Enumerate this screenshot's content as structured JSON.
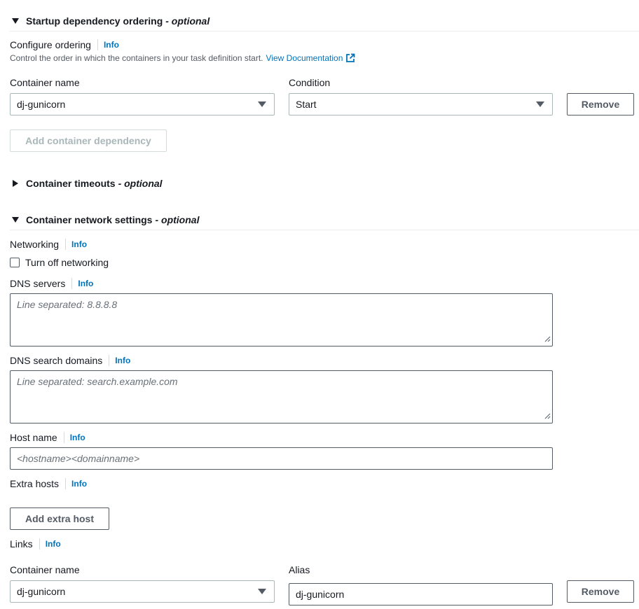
{
  "startup": {
    "title": "Startup dependency ordering",
    "optional": "- optional",
    "configure_label": "Configure ordering",
    "info": "Info",
    "description": "Control the order in which the containers in your task definition start.",
    "doc_link": "View Documentation",
    "container_name_label": "Container name",
    "condition_label": "Condition",
    "container_value": "dj-gunicorn",
    "condition_value": "Start",
    "remove_label": "Remove",
    "add_dependency_label": "Add container dependency"
  },
  "timeouts": {
    "title": "Container timeouts",
    "optional": "- optional"
  },
  "network": {
    "title": "Container network settings",
    "optional": "- optional",
    "networking_label": "Networking",
    "info": "Info",
    "turn_off_label": "Turn off networking",
    "dns_servers_label": "DNS servers",
    "dns_servers_placeholder": "Line separated: 8.8.8.8",
    "dns_search_label": "DNS search domains",
    "dns_search_placeholder": "Line separated: search.example.com",
    "host_name_label": "Host name",
    "host_name_placeholder": "<hostname><domainname>",
    "extra_hosts_label": "Extra hosts",
    "add_extra_host_label": "Add extra host",
    "links_label": "Links",
    "links_container_label": "Container name",
    "alias_label": "Alias",
    "links_container_value": "dj-gunicorn",
    "alias_value": "dj-gunicorn",
    "remove_label": "Remove"
  }
}
